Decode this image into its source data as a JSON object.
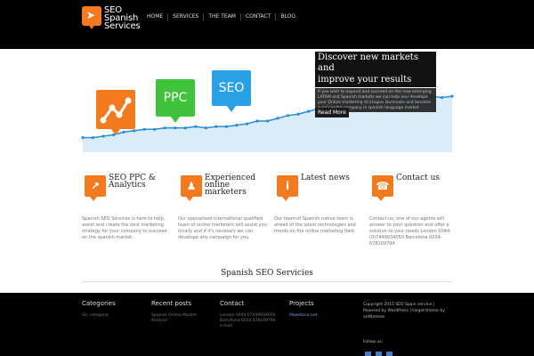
{
  "header": {
    "logo_lines": [
      "SEO",
      "Spanish",
      "Services"
    ],
    "nav": [
      "HOME",
      "SERVICES",
      "THE TEAM",
      "CONTACT",
      "BLOG"
    ]
  },
  "hero": {
    "title_lines": [
      "Discover new markets and",
      "improve your results"
    ],
    "description": "If you wish to expand and succeed on the new emerging LATAM and Spanish markets we can help you develope your Online marketing strategies Dominate and become a successful company in spanish language market",
    "read_more": "Read More",
    "bubbles": {
      "seo": "SEO",
      "ppc": "PPC"
    },
    "trend_values": [
      8,
      8,
      9,
      10,
      12,
      13,
      14,
      14,
      15,
      15,
      15,
      16,
      15,
      16,
      16,
      17,
      18,
      20,
      20,
      22,
      24,
      25,
      27,
      29,
      30,
      32,
      31,
      33,
      34,
      35,
      35,
      36,
      37,
      36,
      38,
      37,
      38
    ]
  },
  "features": [
    {
      "title_lines": [
        "SEO PPC &",
        "Analytics"
      ],
      "text": "Spanish SEO Services is here to help, assist and create the best marketing strategy for your company to succeed on the spanish market.",
      "icon": "chart-icon",
      "glyph": "↗"
    },
    {
      "title_lines": [
        "Experienced",
        "online",
        "marketers"
      ],
      "text": "Our specialised international qualified team of online marketers will assist you locally and if it's necesary we can develope any campaign for you.",
      "icon": "walker-icon",
      "glyph": "♟"
    },
    {
      "title_lines": [
        "Latest news"
      ],
      "text": "Our team of Spanish native team is ahead of the latest technologies and trends on the online marketing field",
      "icon": "info-icon",
      "glyph": "i"
    },
    {
      "title_lines": [
        "Contact us"
      ],
      "text": "Contact us, one of our agents will answer to your question and offer a solution to your needs London 0044-(0)7449934050 Barcelona 0034-678169794",
      "icon": "phone-icon",
      "glyph": "☎"
    }
  ],
  "tagline": "Spanish SEO Servicies",
  "footer": {
    "categories": {
      "heading": "Categories",
      "items": [
        "Sin categoría"
      ]
    },
    "recent_posts": {
      "heading": "Recent posts",
      "items": [
        "Spanish Online Market Analysis"
      ]
    },
    "contact": {
      "heading": "Contact",
      "lines": [
        "London 0044 07449934050",
        "Barcelona 0034 678169794",
        "e-mail"
      ]
    },
    "projects": {
      "heading": "Projects",
      "items": [
        "Mawebica.net"
      ]
    },
    "copyright_lines": [
      "Copyright 2015 SEO Spain service |",
      "Powered by WordPress | target theme by",
      "antthemes"
    ],
    "follow_us": "Follow us:"
  },
  "colors": {
    "orange": "#f47a20",
    "green": "#3ec33a",
    "blue": "#2aa0e6",
    "line": "#2a8fd6",
    "area": "#d9ecf8"
  }
}
